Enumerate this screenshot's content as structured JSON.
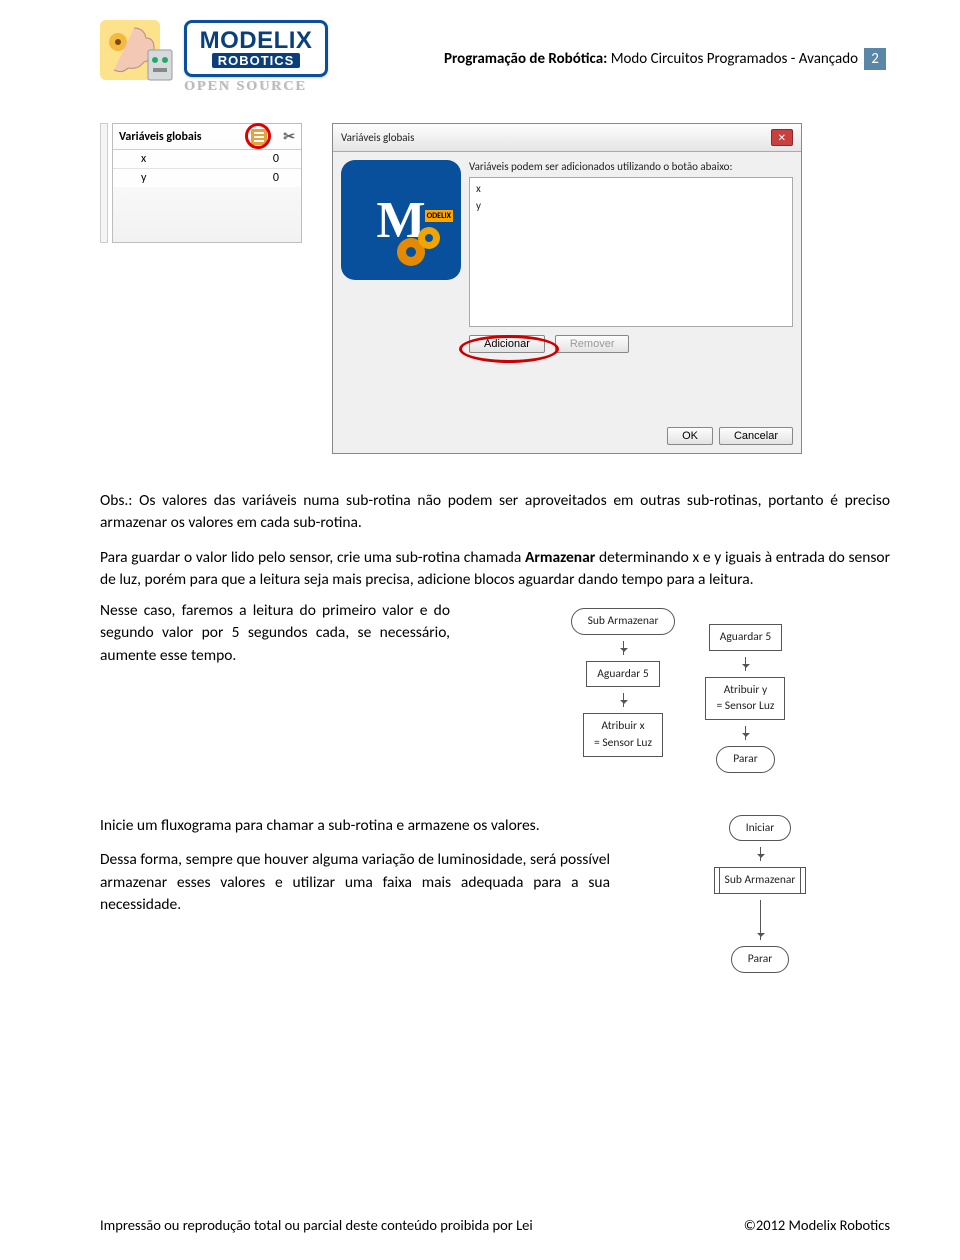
{
  "header": {
    "brand_main": "MODELIX",
    "brand_sub": "ROBOTICS",
    "open_source": "OPEN SOURCE",
    "title_prefix": "Programação de Robótica: ",
    "title_rest": "Modo Circuitos Programados - Avançado",
    "page_number": "2"
  },
  "panel": {
    "title": "Variáveis globais",
    "rows": [
      {
        "name": "x",
        "value": "0"
      },
      {
        "name": "y",
        "value": "0"
      }
    ]
  },
  "dialog": {
    "title": "Variáveis globais",
    "close_x": "✕",
    "hint": "Variáveis podem ser adicionados utilizando o botão abaixo:",
    "list_items": [
      "x",
      "y"
    ],
    "add_label": "Adicionar",
    "remove_label": "Remover",
    "ok_label": "OK",
    "cancel_label": "Cancelar",
    "logo_bar": "ODELIX"
  },
  "text": {
    "obs": "Obs.: Os valores das variáveis numa sub-rotina não podem ser aproveitados em outras sub-rotinas, portanto é preciso armazenar os valores em cada sub-rotina.",
    "p2a": "Para guardar o valor lido pelo sensor, crie uma sub-rotina chamada ",
    "p2b": "Armazenar",
    "p2c": " determinando x e y iguais à entrada do sensor de luz, porém para que a leitura seja mais precisa, adicione blocos aguardar dando tempo para a leitura.",
    "p3": "Nesse caso, faremos a leitura do primeiro valor e do segundo valor por 5 segundos cada, se necessário, aumente esse tempo.",
    "p4": "Inicie um fluxograma para chamar a sub-rotina e armazene os valores.",
    "p5": "Dessa forma, sempre que houver alguma variação de luminosidade, será possível armazenar esses valores e utilizar uma faixa mais adequada para a sua necessidade."
  },
  "flow_left": {
    "n1": "Sub Armazenar",
    "n2": "Aguardar 5",
    "n3": "Atribuir x\n= Sensor Luz"
  },
  "flow_right": {
    "n1": "Aguardar 5",
    "n2": "Atribuir y\n= Sensor Luz",
    "n3": "Parar"
  },
  "flow3": {
    "n1": "Iniciar",
    "n2": "Sub Armazenar",
    "n3": "Parar"
  },
  "footer": {
    "left": "Impressão ou reprodução total ou parcial deste conteúdo proibida por Lei",
    "right": "©2012 Modelix Robotics"
  }
}
